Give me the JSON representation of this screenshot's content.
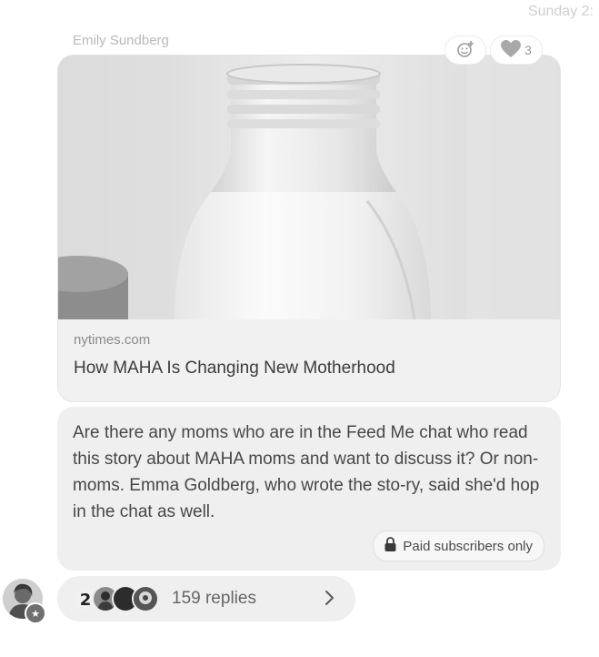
{
  "header": {
    "timestamp": "Sunday 2:"
  },
  "message": {
    "sender": "Emily Sundberg",
    "link": {
      "domain": "nytimes.com",
      "title": "How MAHA Is Changing New Motherhood"
    },
    "reactions": {
      "add_icon": "add-reaction-icon",
      "heart_icon": "heart-icon",
      "heart_count": "3"
    },
    "text": "Are there any moms who are in the Feed Me chat who read this story about MAHA moms and want to discuss it? Or non-moms. Emma Goldberg, who wrote the sto-ry, said she'd hop in the chat as well.",
    "paid_badge": "Paid subscribers only",
    "replies": {
      "count_label": "159 replies",
      "avatar_count": 4
    }
  },
  "colors": {
    "bubble": "#efefef",
    "timestamp": "#cfcfcf",
    "sender": "#b9b9b9"
  }
}
